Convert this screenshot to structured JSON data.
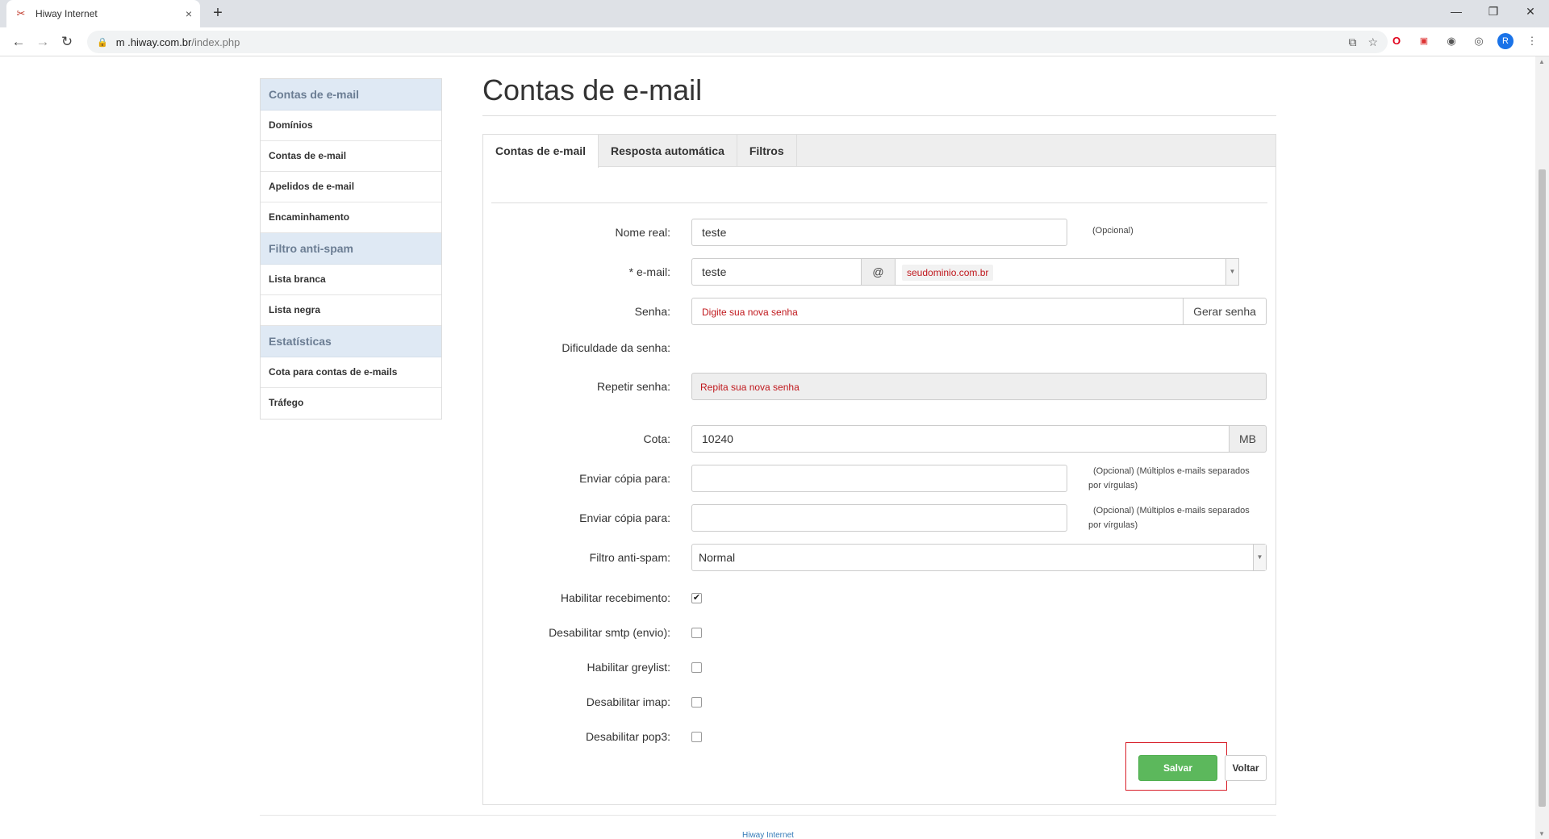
{
  "browser": {
    "tab_title": "Hiway Internet",
    "tab_close": "×",
    "new_tab": "+",
    "url_host": "m     .hiway.com.br",
    "url_path": "/index.php",
    "profile_initial": "R"
  },
  "sidebar": {
    "sections": [
      {
        "title": "Contas de e-mail",
        "items": [
          "Domínios",
          "Contas de e-mail",
          "Apelidos de e-mail",
          "Encaminhamento"
        ]
      },
      {
        "title": "Filtro anti-spam",
        "items": [
          "Lista branca",
          "Lista negra"
        ]
      },
      {
        "title": "Estatísticas",
        "items": [
          "Cota para contas de e-mails",
          "Tráfego"
        ]
      }
    ]
  },
  "page": {
    "title": "Contas de e-mail",
    "tabs": [
      "Contas de e-mail",
      "Resposta automática",
      "Filtros"
    ]
  },
  "form": {
    "real_name": {
      "label": "Nome real:",
      "value": "teste",
      "hint": "(Opcional)"
    },
    "email": {
      "label": "* e-mail:",
      "user": "teste",
      "at": "@",
      "domain": "seudominio.com.br"
    },
    "password": {
      "label": "Senha:",
      "placeholder": "Digite sua nova senha",
      "generate_button": "Gerar senha"
    },
    "strength": {
      "label": "Dificuldade da senha:"
    },
    "repeat": {
      "label": "Repetir senha:",
      "placeholder": "Repita sua nova senha"
    },
    "quota": {
      "label": "Cota:",
      "value": "10240",
      "unit": "MB"
    },
    "cc1": {
      "label": "Enviar cópia para:",
      "value": "",
      "hint_line1": "(Opcional) (Múltiplos e-mails separados",
      "hint_line2": "por vírgulas)"
    },
    "cc2": {
      "label": "Enviar cópia para:",
      "value": "",
      "hint_line1": "(Opcional) (Múltiplos e-mails separados",
      "hint_line2": "por vírgulas)"
    },
    "antispam": {
      "label": "Filtro anti-spam:",
      "value": "Normal"
    },
    "checkboxes": [
      {
        "label": "Habilitar recebimento:",
        "checked": true
      },
      {
        "label": "Desabilitar smtp (envio):",
        "checked": false
      },
      {
        "label": "Habilitar greylist:",
        "checked": false
      },
      {
        "label": "Desabilitar imap:",
        "checked": false
      },
      {
        "label": "Desabilitar pop3:",
        "checked": false
      }
    ],
    "save_button": "Salvar",
    "back_button": "Voltar"
  },
  "footer": {
    "text": "Hiway Internet"
  },
  "colors": {
    "save": "#5cb85c",
    "highlight": "#d8202a",
    "sidebar_header": "#dfe9f4"
  }
}
